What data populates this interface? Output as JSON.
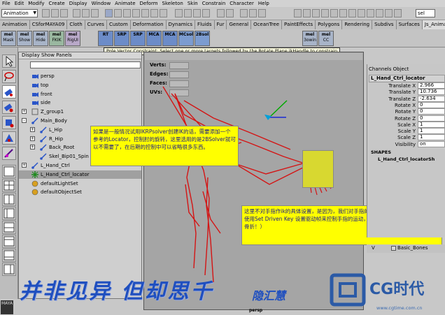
{
  "menubar": [
    "File",
    "Edit",
    "Modify",
    "Create",
    "Display",
    "Window",
    "Animate",
    "Deform",
    "Skeleton",
    "Skin",
    "Constrain",
    "Character",
    "Help"
  ],
  "status": {
    "mode": "Animation",
    "select_field": "sel"
  },
  "shelf_tabs": [
    "Animation",
    "CSforMAYA09",
    "Cloth",
    "Curves",
    "Custom",
    "Deformation",
    "Dynamics",
    "Fluids",
    "Fur",
    "General",
    "OceanTree",
    "PaintEffects",
    "Polygons",
    "Rendering",
    "Subdivs",
    "Surfaces",
    "Js_Animation"
  ],
  "active_shelf_tab": "Js_Animation",
  "shelf_buttons": [
    {
      "l1": "mel",
      "l2": "Mask"
    },
    {
      "l1": "mel",
      "l2": "Show"
    },
    {
      "l1": "mel",
      "l2": "Hide"
    },
    {
      "l1": "mel",
      "l2": "FKIK"
    },
    {
      "l1": "mel",
      "l2": "RigUI"
    },
    {
      "l1": "RT",
      "l2": ""
    },
    {
      "l1": "SRP",
      "l2": ""
    },
    {
      "l1": "SRP",
      "l2": ""
    },
    {
      "l1": "MCA",
      "l2": ""
    },
    {
      "l1": "MCA",
      "l2": ""
    },
    {
      "l1": "MCsol",
      "l2": ""
    },
    {
      "l1": "2Bsol",
      "l2": ""
    },
    {
      "l1": "mel",
      "l2": "3owin"
    },
    {
      "l1": "mel",
      "l2": "CC"
    }
  ],
  "help_line": "Pole Vector Constraint: Select one or more targets followed by the Rotate Plane ikHandle to constrain",
  "outliner": {
    "header": "Display  Show  Panels",
    "items": [
      {
        "label": "persp",
        "depth": 0,
        "expand": "",
        "icon": "camera-icon"
      },
      {
        "label": "top",
        "depth": 0,
        "expand": "",
        "icon": "camera-icon"
      },
      {
        "label": "front",
        "depth": 0,
        "expand": "",
        "icon": "camera-icon"
      },
      {
        "label": "side",
        "depth": 0,
        "expand": "",
        "icon": "camera-icon"
      },
      {
        "label": "Z_group1",
        "depth": 0,
        "expand": "+",
        "icon": "group-icon"
      },
      {
        "label": "Main_Body",
        "depth": 0,
        "expand": "-",
        "icon": "joint-icon"
      },
      {
        "label": "L_Hip",
        "depth": 1,
        "expand": "+",
        "icon": "joint-icon"
      },
      {
        "label": "R_Hip",
        "depth": 1,
        "expand": "+",
        "icon": "joint-icon"
      },
      {
        "label": "Back_Root",
        "depth": 1,
        "expand": "+",
        "icon": "joint-icon"
      },
      {
        "label": "Skel_Bip01_Spin",
        "depth": 1,
        "expand": "",
        "icon": "joint-icon"
      },
      {
        "label": "L_Hand_Ctrl",
        "depth": 0,
        "expand": "+",
        "icon": "joint-icon"
      },
      {
        "label": "L_Hand_Ctrl_locator",
        "depth": 0,
        "expand": "",
        "icon": "locator-icon",
        "selected": true
      },
      {
        "label": "defaultLightSet",
        "depth": 0,
        "expand": "",
        "icon": "set-icon"
      },
      {
        "label": "defaultObjectSet",
        "depth": 0,
        "expand": "",
        "icon": "set-icon"
      }
    ]
  },
  "viewport": {
    "hud": [
      {
        "label": "Verts:"
      },
      {
        "label": "Edges:"
      },
      {
        "label": "Faces:"
      },
      {
        "label": "UVs:"
      }
    ],
    "camera": "persp"
  },
  "notes": {
    "note1": "如果是一般情况试用IKRPsolver创建IK的话，需要添加一个参考的Locator，控制肘的旋转，这里选用的是2BSolver就可以不需要了，在后期的控制中可以省略很多东西。",
    "note2": "这里不对手指作ik的具体设置，是因为，我们对手指的控制要求的精度非常高，将会使用Set Driven Key 设置驱动帧来控制手指的运动，包括曲卷，伸直，平移（不是骨折！）"
  },
  "channel_box": {
    "header": "Channels  Object",
    "node": "L_Hand_Ctrl_locator",
    "channels": [
      {
        "name": "Translate X",
        "value": "2.966"
      },
      {
        "name": "Translate Y",
        "value": "10.736"
      },
      {
        "name": "Translate Z",
        "value": "-2.634"
      },
      {
        "name": "Rotate X",
        "value": "0"
      },
      {
        "name": "Rotate Y",
        "value": "0"
      },
      {
        "name": "Rotate Z",
        "value": "0"
      },
      {
        "name": "Scale X",
        "value": "1"
      },
      {
        "name": "Scale Y",
        "value": "1"
      },
      {
        "name": "Scale Z",
        "value": "1"
      },
      {
        "name": "Visibility",
        "value": "on"
      }
    ],
    "shapes_label": "SHAPES",
    "shape_name": "L_Hand_Ctrl_locatorSh"
  },
  "layer": {
    "visible": "V",
    "name": "Basic_Bones"
  },
  "banner": {
    "text": "并非见异 但却思千",
    "signature": "隐汇慧"
  },
  "brand": {
    "name": "CG时代",
    "url": "www.cgtime.com.cn"
  },
  "maya_logo": "MAYA"
}
